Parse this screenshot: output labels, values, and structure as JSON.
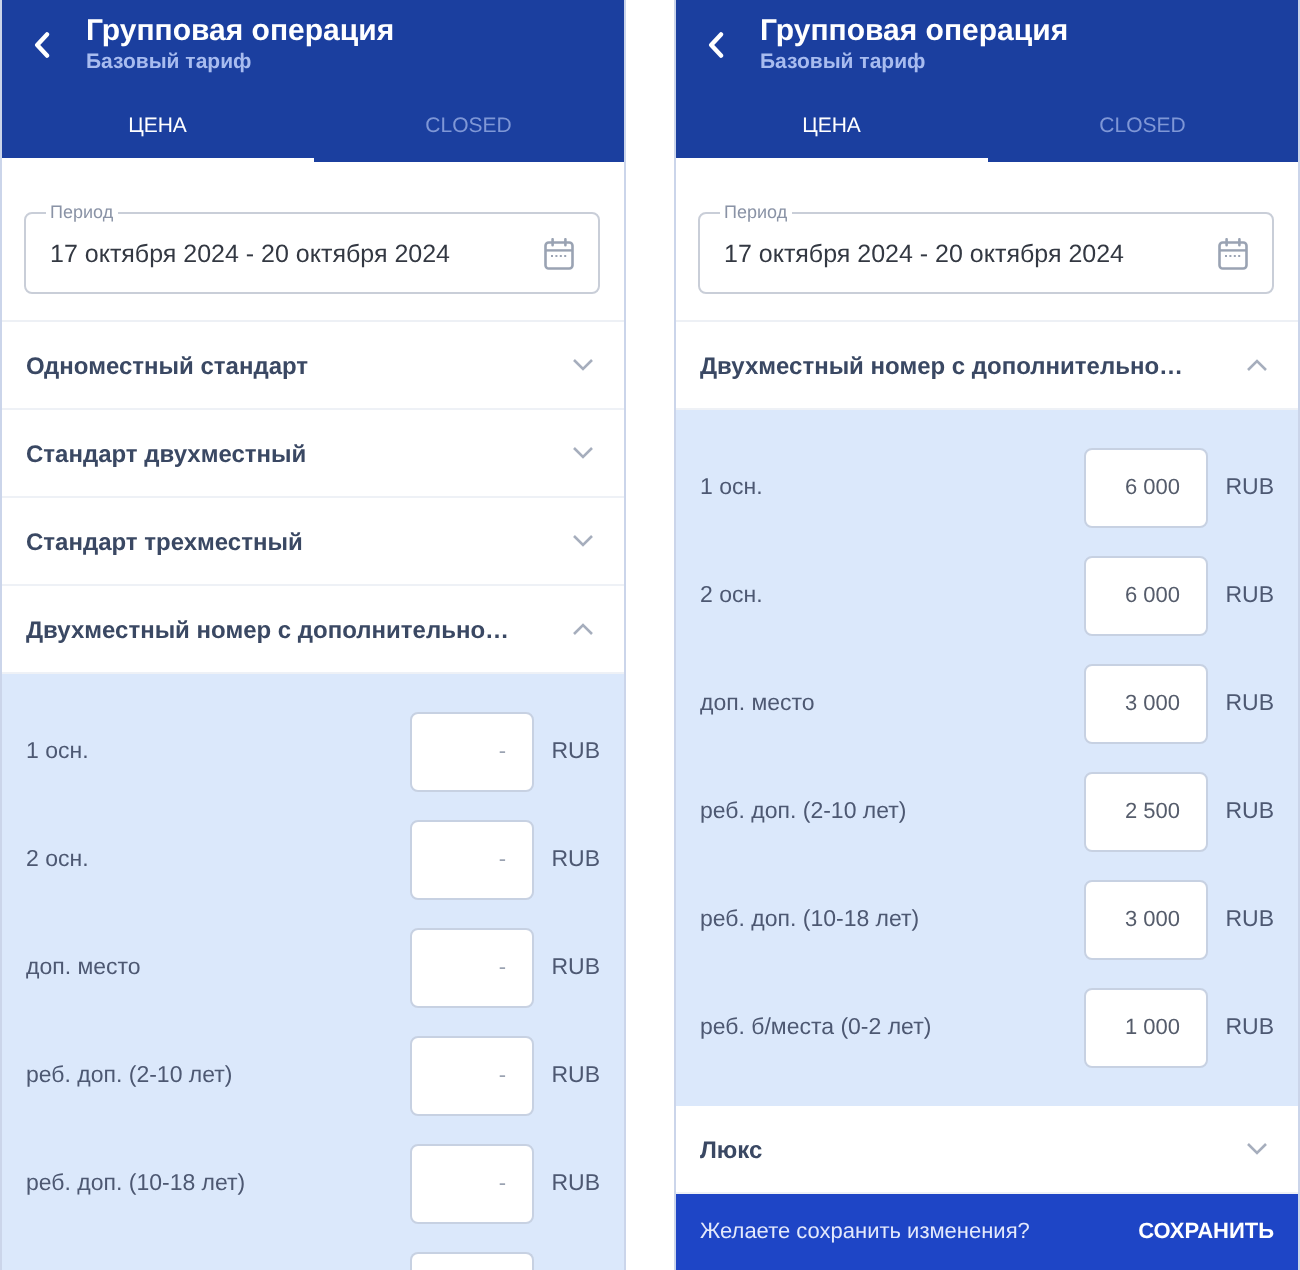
{
  "screens": [
    {
      "header": {
        "title": "Групповая операция",
        "subtitle": "Базовый тариф"
      },
      "tabs": [
        {
          "label": "ЦЕНА",
          "selected": true
        },
        {
          "label": "CLOSED",
          "selected": false
        }
      ],
      "period": {
        "label": "Период",
        "value": "17 октября 2024 - 20 октября 2024"
      },
      "rooms": [
        {
          "name": "Одноместный стандарт",
          "expanded": false
        },
        {
          "name": "Стандарт двухместный",
          "expanded": false
        },
        {
          "name": "Стандарт трехместный",
          "expanded": false
        },
        {
          "name": "Двухместный номер с дополнительно…",
          "expanded": true,
          "prices": [
            {
              "label": "1 осн.",
              "placeholder": "-",
              "unit": "RUB"
            },
            {
              "label": "2 осн.",
              "placeholder": "-",
              "unit": "RUB"
            },
            {
              "label": "доп. место",
              "placeholder": "-",
              "unit": "RUB"
            },
            {
              "label": "реб. доп. (2-10 лет)",
              "placeholder": "-",
              "unit": "RUB"
            },
            {
              "label": "реб. доп. (10-18 лет)",
              "placeholder": "-",
              "unit": "RUB"
            },
            {
              "cut": true
            }
          ]
        }
      ]
    },
    {
      "header": {
        "title": "Групповая операция",
        "subtitle": "Базовый тариф"
      },
      "tabs": [
        {
          "label": "ЦЕНА",
          "selected": true
        },
        {
          "label": "CLOSED",
          "selected": false
        }
      ],
      "period": {
        "label": "Период",
        "value": "17 октября 2024 - 20 октября 2024"
      },
      "rooms": [
        {
          "name": "Двухместный номер с дополнительно…",
          "expanded": true,
          "prices": [
            {
              "label": "1 осн.",
              "value": "6 000",
              "unit": "RUB"
            },
            {
              "label": "2 осн.",
              "value": "6 000",
              "unit": "RUB"
            },
            {
              "label": "доп. место",
              "value": "3 000",
              "unit": "RUB"
            },
            {
              "label": "реб. доп. (2-10 лет)",
              "value": "2 500",
              "unit": "RUB"
            },
            {
              "label": "реб. доп. (10-18 лет)",
              "value": "3 000",
              "unit": "RUB"
            },
            {
              "label": "реб. б/места (0-2 лет)",
              "value": "1 000",
              "unit": "RUB"
            }
          ]
        },
        {
          "name": "Люкс",
          "expanded": false
        }
      ],
      "save_bar": {
        "prompt": "Желаете сохранить изменения?",
        "action": "СОХРАНИТЬ"
      }
    }
  ]
}
